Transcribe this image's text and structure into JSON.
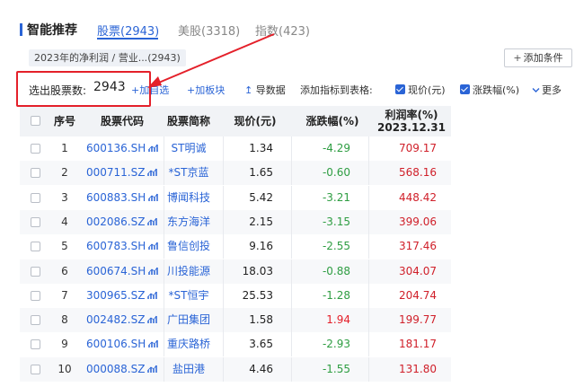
{
  "header": {
    "title": "智能推荐",
    "tabs": [
      {
        "label": "股票(2943)",
        "active": true
      },
      {
        "label": "美股(3318)",
        "active": false
      },
      {
        "label": "指数(423)",
        "active": false
      }
    ]
  },
  "condition_chip": {
    "text": "2023年的净利润 / 营业...",
    "count": "(2943)"
  },
  "add_condition": {
    "plus": "+",
    "label": "添加条件"
  },
  "toolbar": {
    "selected_label": "选出股票数:",
    "selected_count": "2943",
    "add_watchlist": "+加自选",
    "add_block": "+加板块",
    "export_icon": "↥",
    "export": "导数据",
    "add_indicator": "添加指标到表格:",
    "price_check": "现价(元)",
    "change_check": "涨跌幅(%)",
    "more": "更多"
  },
  "colors": {
    "accent": "#2a64d6",
    "up": "#e4202a",
    "down": "#2e9d42",
    "highlight": "#e4202a"
  },
  "table": {
    "headers": {
      "seq": "序号",
      "code": "股票代码",
      "name": "股票简称",
      "price": "现价(元)",
      "change": "涨跌幅(%)",
      "profit_line1": "利润率(%)",
      "profit_line2": "2023.12.31"
    },
    "rows": [
      {
        "seq": "1",
        "code": "600136.SH",
        "name": "ST明诚",
        "price": "1.34",
        "change": "-4.29",
        "dir": "down",
        "profit": "709.17"
      },
      {
        "seq": "2",
        "code": "000711.SZ",
        "name": "*ST京蓝",
        "price": "1.65",
        "change": "-0.60",
        "dir": "down",
        "profit": "568.16"
      },
      {
        "seq": "3",
        "code": "600883.SH",
        "name": "博闻科技",
        "price": "5.42",
        "change": "-3.21",
        "dir": "down",
        "profit": "448.42"
      },
      {
        "seq": "4",
        "code": "002086.SZ",
        "name": "东方海洋",
        "price": "2.15",
        "change": "-3.15",
        "dir": "down",
        "profit": "399.06"
      },
      {
        "seq": "5",
        "code": "600783.SH",
        "name": "鲁信创投",
        "price": "9.16",
        "change": "-2.55",
        "dir": "down",
        "profit": "317.46"
      },
      {
        "seq": "6",
        "code": "600674.SH",
        "name": "川投能源",
        "price": "18.03",
        "change": "-0.88",
        "dir": "down",
        "profit": "304.07"
      },
      {
        "seq": "7",
        "code": "300965.SZ",
        "name": "*ST恒宇",
        "price": "25.53",
        "change": "-1.28",
        "dir": "down",
        "profit": "204.74"
      },
      {
        "seq": "8",
        "code": "002482.SZ",
        "name": "广田集团",
        "price": "1.58",
        "change": "1.94",
        "dir": "up",
        "profit": "199.77"
      },
      {
        "seq": "9",
        "code": "600106.SH",
        "name": "重庆路桥",
        "price": "3.65",
        "change": "-2.93",
        "dir": "down",
        "profit": "181.17"
      },
      {
        "seq": "10",
        "code": "000088.SZ",
        "name": "盐田港",
        "price": "4.46",
        "change": "-1.55",
        "dir": "down",
        "profit": "131.80"
      }
    ]
  }
}
